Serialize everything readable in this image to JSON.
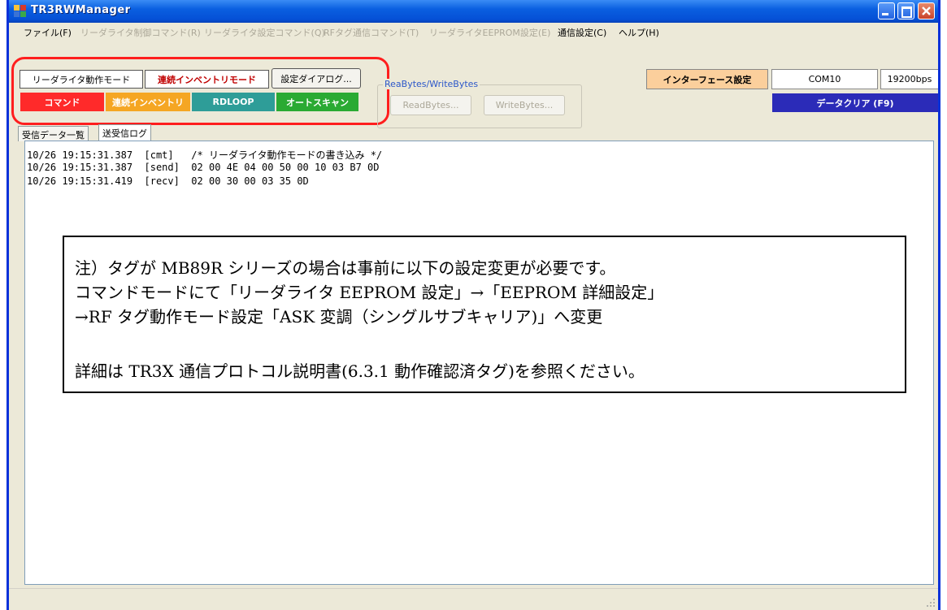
{
  "window": {
    "title": "TR3RWManager"
  },
  "menu": [
    {
      "label": "ファイル(F)",
      "enabled": true
    },
    {
      "label": "リーダライタ制御コマンド(R)",
      "enabled": false
    },
    {
      "label": "リーダライタ設定コマンド(Q)",
      "enabled": false
    },
    {
      "label": "RFタグ通信コマンド(T)",
      "enabled": false
    },
    {
      "label": "リーダライタEEPROM設定(E)",
      "enabled": false
    },
    {
      "label": "通信設定(C)",
      "enabled": true
    },
    {
      "label": "ヘルプ(H)",
      "enabled": true
    }
  ],
  "toolbar": {
    "mode_label": "リーダライタ動作モード",
    "mode_value": "連続インベントリモード",
    "settings_dialog": "設定ダイアログ...",
    "command": "コマンド",
    "continuous_inventory": "連続インベントリ",
    "rdloop": "RDLOOP",
    "autoscan": "オートスキャン",
    "group_label": "ReaBytes/WriteBytes",
    "readbytes": "ReadBytes...",
    "writebytes": "WriteBytes...",
    "interface_settings": "インターフェース設定",
    "port": "COM10",
    "baud": "19200bps",
    "clear_data": "データクリア (F9)"
  },
  "tabs": [
    {
      "label": "受信データ一覧",
      "active": false
    },
    {
      "label": "送受信ログ",
      "active": true
    }
  ],
  "log": [
    "10/26 19:15:31.387  [cmt]   /* リーダライタ動作モードの書き込み */",
    "10/26 19:15:31.387  [send]  02 00 4E 04 00 50 00 10 03 B7 0D",
    "10/26 19:15:31.419  [recv]  02 00 30 00 03 35 0D"
  ],
  "note": {
    "line1": "注）タグが MB89R シリーズの場合は事前に以下の設定変更が必要です。",
    "line2": "コマンドモードにて「リーダライタ EEPROM 設定」→「EEPROM 詳細設定」",
    "line3": "→RF タグ動作モード設定「ASK 変調（シングルサブキャリア)」へ変更",
    "line4": "詳細は TR3X 通信プロトコル説明書(6.3.1 動作確認済タグ)を参照ください。"
  },
  "colors": {
    "command": "#ff2a2a",
    "continuous_inventory": "#f5a623",
    "rdloop": "#2e9d98",
    "autoscan": "#2aaa33",
    "interface_settings": "#fbcf9c",
    "clear_data": "#2b2bb8",
    "mode_value_text": "#c00000",
    "highlight": "#ff1e1e"
  }
}
